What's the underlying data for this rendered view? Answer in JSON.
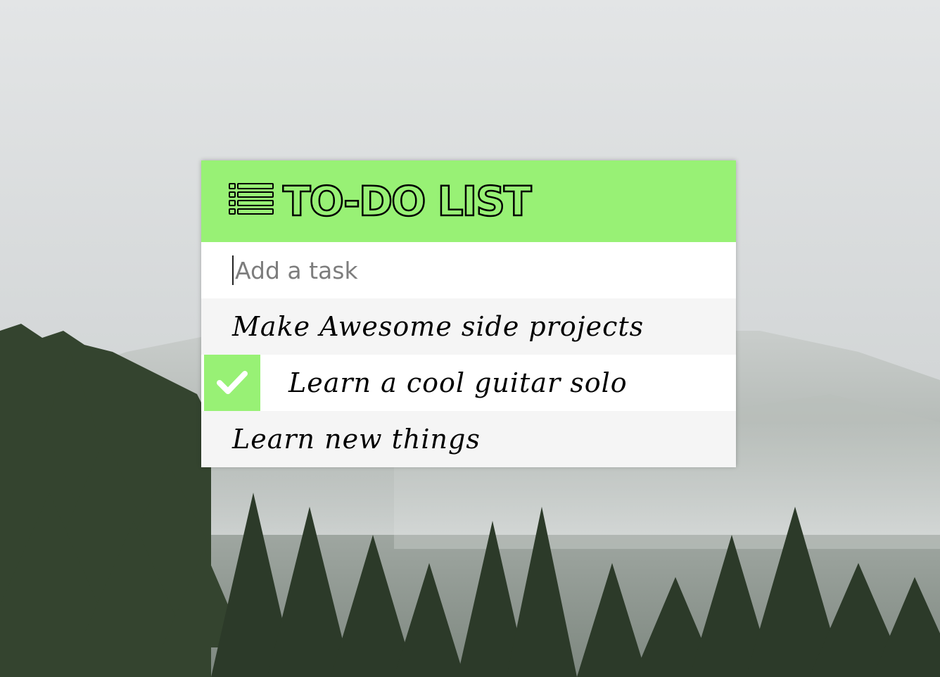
{
  "colors": {
    "accent": "#98f175",
    "card_bg": "#ffffff",
    "alt_row_bg": "#f5f5f5",
    "text": "#000000"
  },
  "header": {
    "icon": "list-icon",
    "title": "TO-DO LIST"
  },
  "add_task": {
    "placeholder": "Add a task",
    "value": ""
  },
  "tasks": [
    {
      "label": "Make Awesome side projects",
      "completed": false
    },
    {
      "label": "Learn a cool guitar solo",
      "completed": true,
      "icon": "check-icon"
    },
    {
      "label": "Learn new things",
      "completed": false
    }
  ]
}
